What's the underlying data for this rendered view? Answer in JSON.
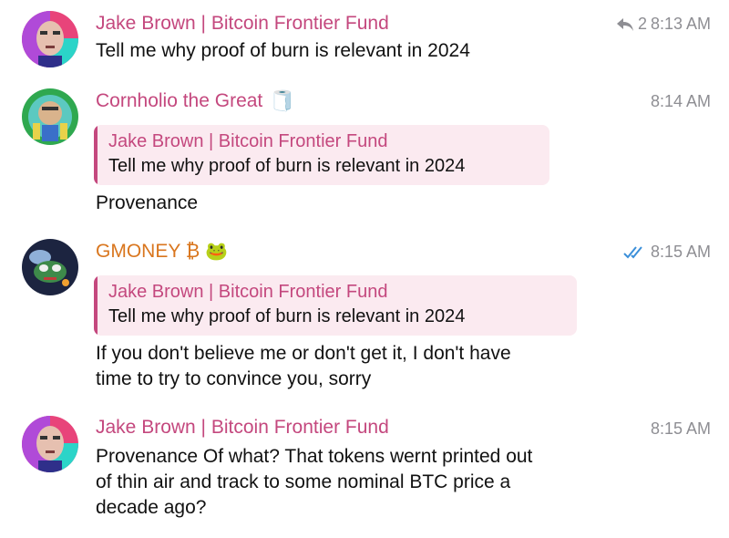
{
  "messages": [
    {
      "sender": "Jake Brown | Bitcoin Frontier Fund",
      "reply_count": "2",
      "time": "8:13 AM",
      "text": "Tell me why proof of burn is relevant in 2024"
    },
    {
      "sender": "Cornholio the Great",
      "sender_emoji": "🧻",
      "time": "8:14 AM",
      "reply_to_name": "Jake Brown | Bitcoin Frontier Fund",
      "reply_to_text": "Tell me why proof of burn is relevant in 2024",
      "text": "Provenance"
    },
    {
      "sender": "GMONEY ₿",
      "sender_emoji": "🐸",
      "time": "8:15 AM",
      "reply_to_name": "Jake Brown | Bitcoin Frontier Fund",
      "reply_to_text": "Tell me why proof of burn is relevant in 2024",
      "text_lines": [
        "If you don't believe me or don't get it, I don't have",
        "time to try to convince you, sorry"
      ]
    },
    {
      "sender": "Jake Brown | Bitcoin Frontier Fund",
      "time": "8:15 AM",
      "text_lines": [
        "Provenance Of what? That tokens wernt printed out",
        "of thin air and track to some nominal BTC price a",
        "decade ago?"
      ]
    }
  ],
  "icons": {
    "reply": "reply-arrow-icon",
    "read": "double-check-icon"
  },
  "colors": {
    "sender_pink": "#c4487e",
    "sender_orange": "#d9761e",
    "reply_bg": "#fbeaf0",
    "time_gray": "#8e8e93",
    "check_blue": "#3b8fd9"
  }
}
